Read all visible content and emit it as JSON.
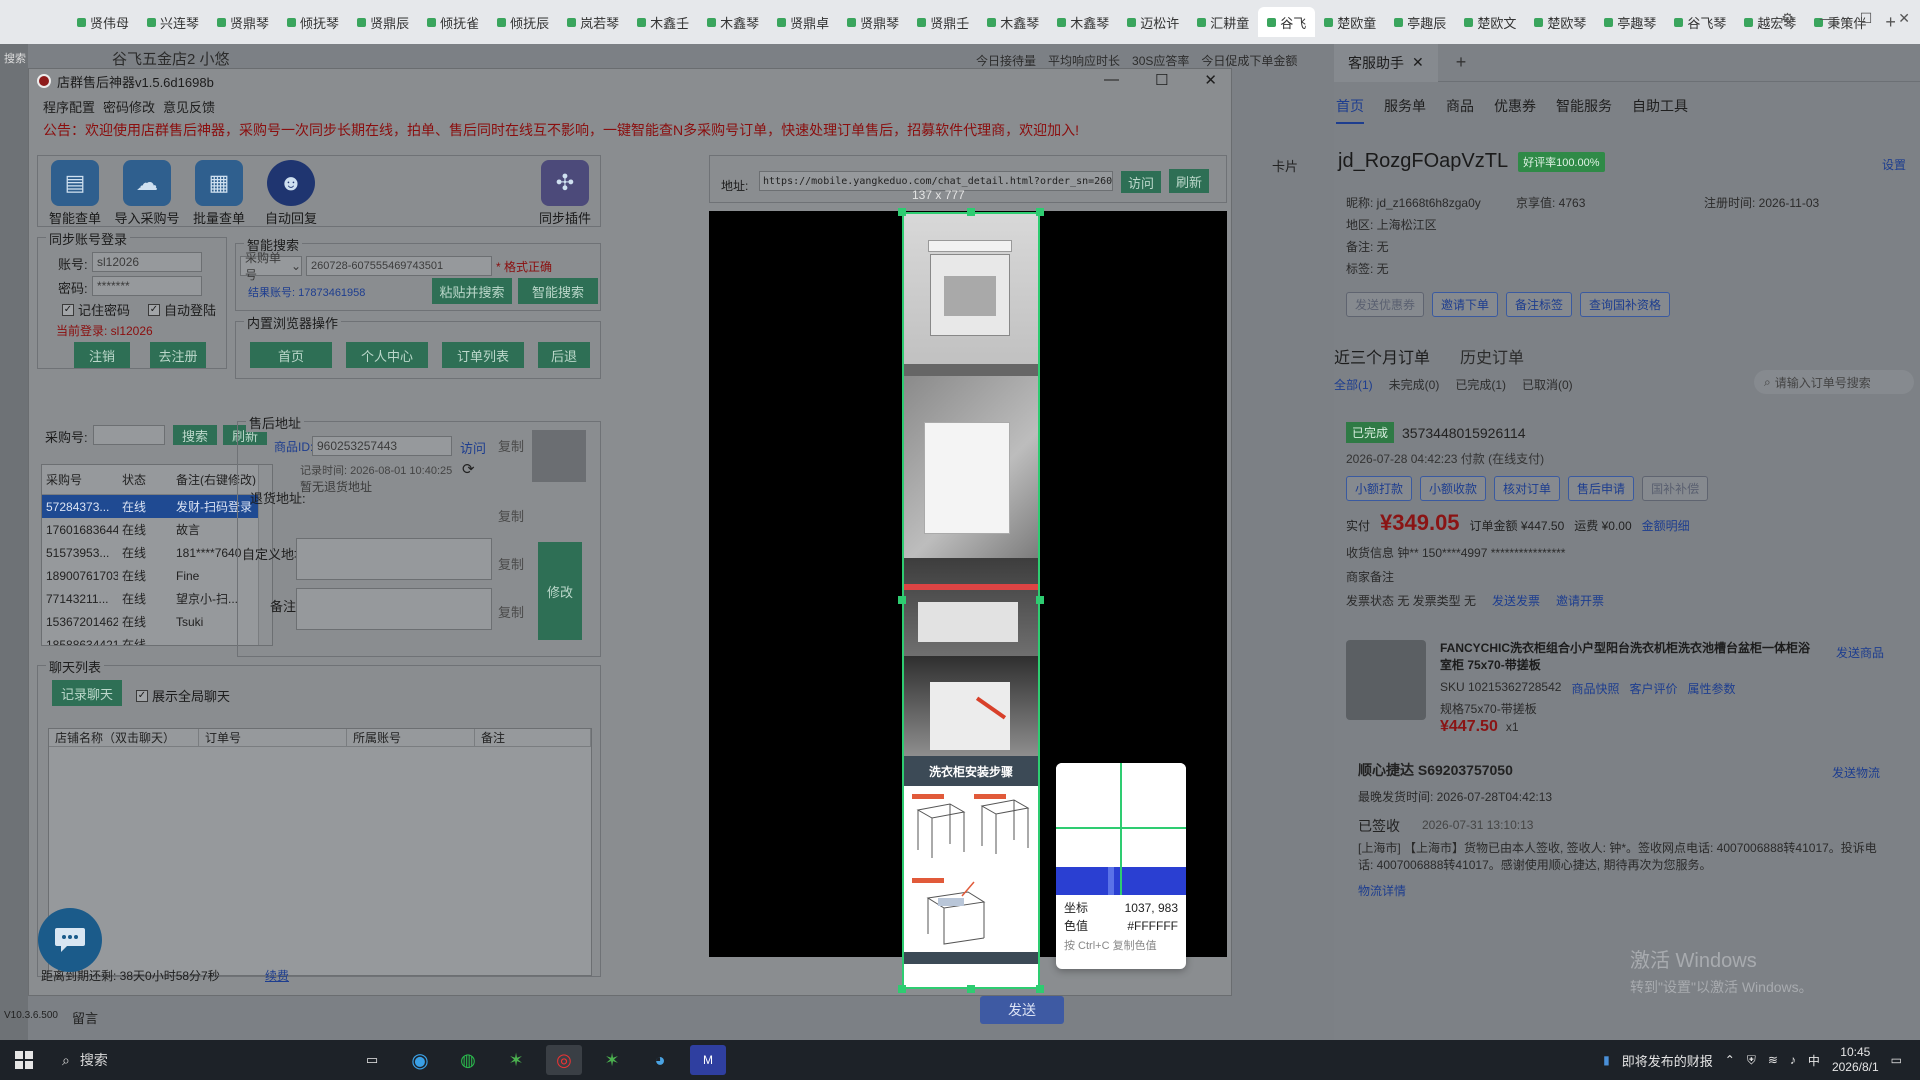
{
  "tabs": [
    "贤伟母",
    "兴连琴",
    "贤鼎琴",
    "倾抚琴",
    "贤鼎辰",
    "倾抚雀",
    "倾抚辰",
    "岚若琴",
    "木鑫壬",
    "木鑫琴",
    "贤鼎卓",
    "贤鼎琴",
    "贤鼎壬",
    "木鑫琴",
    "木鑫琴",
    "迈松许",
    "汇耕童",
    "谷飞",
    "楚欧童",
    "亭趣辰",
    "楚欧文",
    "楚欧琴",
    "亭趣琴",
    "谷飞琴",
    "越宏琴",
    "秉策伴"
  ],
  "active_tab_index": 17,
  "bg": {
    "search": "搜索",
    "shop_title": "谷飞五金店2 小悠",
    "stats": [
      "今日接待量",
      "平均响应时长",
      "30S应答率",
      "今日促成下单金额"
    ],
    "version": "V10.3.6.500",
    "note": "留言",
    "send": "发送",
    "card": "卡片"
  },
  "app": {
    "title": "店群售后神器v1.5.6d1698b",
    "menu": [
      "程序配置",
      "密码修改",
      "意见反馈"
    ],
    "notice": "公告：欢迎使用店群售后神器，采购号一次同步长期在线，拍单、售后同时在线互不影响，一键智能查N多采购号订单，快速处理订单售后，招募软件代理商，欢迎加入!",
    "tools": [
      "智能查单",
      "导入采购号",
      "批量查单",
      "自动回复"
    ],
    "plugin": "同步插件",
    "sync": {
      "title": "同步账号登录",
      "account_label": "账号:",
      "account_value": "sl12026",
      "password_label": "密码:",
      "password_value": "*******",
      "remember": "记住密码",
      "auto_login": "自动登陆",
      "current": "当前登录: sl12026",
      "logout": "注销",
      "register": "去注册"
    },
    "smart": {
      "title": "智能搜索",
      "select": "采购单号",
      "order_no": "260728-607555469743501",
      "format_ok": "* 格式正确",
      "result": "结果账号: 17873461958",
      "paste_search": "粘贴并搜索",
      "smart_search": "智能搜索"
    },
    "browser": {
      "title": "内置浏览器操作",
      "buttons": [
        "首页",
        "个人中心",
        "订单列表",
        "后退"
      ]
    },
    "purchase": {
      "label": "采购号:",
      "search": "搜索",
      "refresh": "刷新",
      "headers": [
        "采购号",
        "状态",
        "备注(右键修改)"
      ],
      "rows": [
        [
          "57284373...",
          "在线",
          "发财-扫码登录"
        ],
        [
          "17601683644",
          "在线",
          "故言"
        ],
        [
          "51573953...",
          "在线",
          "181****7640"
        ],
        [
          "18900761703",
          "在线",
          "Fine"
        ],
        [
          "77143211...",
          "在线",
          "望京小-扫..."
        ],
        [
          "15367201462",
          "在线",
          "Tsuki"
        ],
        [
          "18588634421",
          "在线",
          ""
        ]
      ]
    },
    "after_sale": {
      "title": "售后地址",
      "product_label": "商品ID:",
      "product_id": "960253257443",
      "visit": "访问",
      "copy": "复制",
      "record_time": "记录时间: 2026-08-01 10:40:25",
      "no_address": "暂无退货地址",
      "return_label": "退货地址:",
      "custom_label": "自定义地址:",
      "remark_label": "备注:",
      "modify": "修改"
    },
    "chat": {
      "title": "聊天列表",
      "record": "记录聊天",
      "show_all": "展示全局聊天",
      "headers": [
        "店铺名称（双击聊天）",
        "订单号",
        "所属账号",
        "备注"
      ]
    },
    "expire": "距离到期还剩: 38天0小时58分7秒",
    "renew": "续费",
    "address_label": "地址:",
    "address_value": "https://mobile.yangkeduo.com/chat_detail.html?order_sn=260",
    "visit_btn": "访问",
    "refresh_btn": "刷新"
  },
  "capture": {
    "size": "137 x 777",
    "banner": "洗衣柜安装步骤"
  },
  "magnifier": {
    "coord_label": "坐标",
    "coord_value": "1037, 983",
    "color_label": "色值",
    "color_value": "#FFFFFF",
    "hint": "按 Ctrl+C 复制色值"
  },
  "cs": {
    "tab": "客服助手",
    "nav": [
      "首页",
      "服务单",
      "商品",
      "优惠券",
      "智能服务",
      "自助工具"
    ],
    "user": "jd_RozgFOapVzTL",
    "badge": "好评率100.00%",
    "settings": "设置",
    "nickname": "昵称: jd_z1668t6h8zga0y",
    "jingxiang": "京享值: 4763",
    "reg": "注册时间: 2026-11-03",
    "region": "地区: 上海松江区",
    "remark": "备注: 无",
    "tags": "标签: 无",
    "btns": [
      "发送优惠券",
      "邀请下单",
      "备注标签",
      "查询国补资格"
    ],
    "order_tabs": [
      "近三个月订单",
      "历史订单"
    ],
    "filters": [
      "全部(1)",
      "未完成(0)",
      "已完成(1)",
      "已取消(0)"
    ],
    "order_search": "请输入订单号搜索",
    "status": "已完成",
    "order_no": "3573448015926114",
    "order_time": "2026-07-28 04:42:23 付款 (在线支付)",
    "order_btns": [
      "小额打款",
      "小额收款",
      "核对订单",
      "售后申请",
      "国补补偿"
    ],
    "paid_label": "实付",
    "paid": "¥349.05",
    "order_amount": "订单金额 ¥447.50",
    "freight": "运费 ¥0.00",
    "amount_detail": "金额明细",
    "receiver": "收货信息 钟**    150****4997    ****************",
    "merchant_note": "商家备注",
    "invoice": "发票状态 无   发票类型 无",
    "send_invoice": "发送发票",
    "invite_invoice": "邀请开票",
    "product_title": "FANCYCHIC洗衣柜组合小户型阳台洗衣机柜洗衣池槽台盆柜一体柜浴室柜 75x70-带搓板",
    "send_product": "发送商品",
    "sku": "SKU 10215362728542",
    "sku_links": [
      "商品快照",
      "客户评价",
      "属性参数"
    ],
    "spec": "规格75x70-带搓板",
    "price": "¥447.50",
    "qty": "x1",
    "logistics": "顺心捷达 S69203757050",
    "send_logistics": "发送物流",
    "latest_ship": "最晚发货时间: 2026-07-28T04:42:13",
    "signed": "已签收",
    "signed_time": "2026-07-31 13:10:13",
    "signed_detail": "[上海市] 【上海市】货物已由本人签收, 签收人: 钟*。签收网点电话: 4007006888转41017。投诉电话: 4007006888转41017。感谢使用顺心捷达, 期待再次为您服务。",
    "logistics_detail": "物流详情"
  },
  "watermark": {
    "line1": "激活 Windows",
    "line2": "转到\"设置\"以激活 Windows。"
  },
  "taskbar": {
    "search": "搜索",
    "news": "即将发布的财报",
    "ime": "中",
    "time": "10:45",
    "date": "2026/8/1"
  }
}
